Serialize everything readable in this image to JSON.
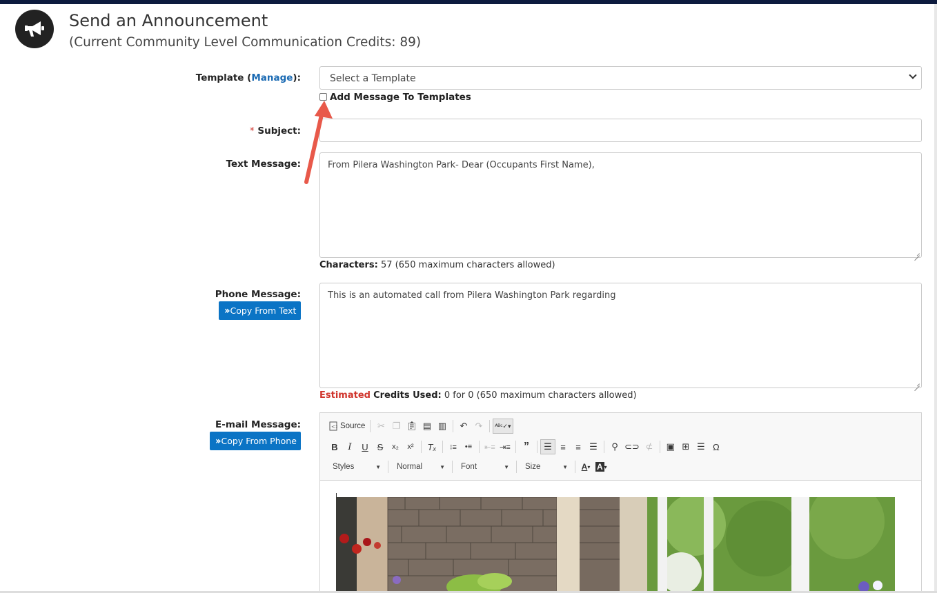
{
  "header": {
    "title": "Send an Announcement",
    "subtitle": "(Current Community Level Communication Credits: 89)",
    "icon": "megaphone-icon"
  },
  "template": {
    "label_prefix": "Template (",
    "manage_link": "Manage",
    "label_suffix": "):",
    "select_value": "Select a Template",
    "add_to_templates_label": "Add Message To Templates",
    "add_to_templates_checked": false
  },
  "subject": {
    "required_mark": "*",
    "label": "Subject:",
    "value": ""
  },
  "text_message": {
    "label": "Text Message:",
    "value": "From Pilera Washington Park- Dear (Occupants First Name),",
    "counter_label": "Characters:",
    "counter_value": "57 (650 maximum characters allowed)"
  },
  "phone_message": {
    "label": "Phone Message:",
    "copy_button": "Copy From Text",
    "value": "This is an automated call from Pilera Washington Park regarding",
    "estimated_label": "Estimated",
    "credits_label": "Credits Used:",
    "credits_value": "0 for 0 (650 maximum characters allowed)"
  },
  "email_message": {
    "label": "E-mail Message:",
    "copy_button": "Copy From Phone",
    "toolbar": {
      "source_label": "Source",
      "styles_label": "Styles",
      "format_label": "Normal",
      "font_label": "Font",
      "size_label": "Size"
    }
  },
  "colors": {
    "accent_blue": "#0b74c5",
    "link_blue": "#1a6ab3",
    "required_red": "#d0342c",
    "annotation_arrow": "#e8594a"
  }
}
